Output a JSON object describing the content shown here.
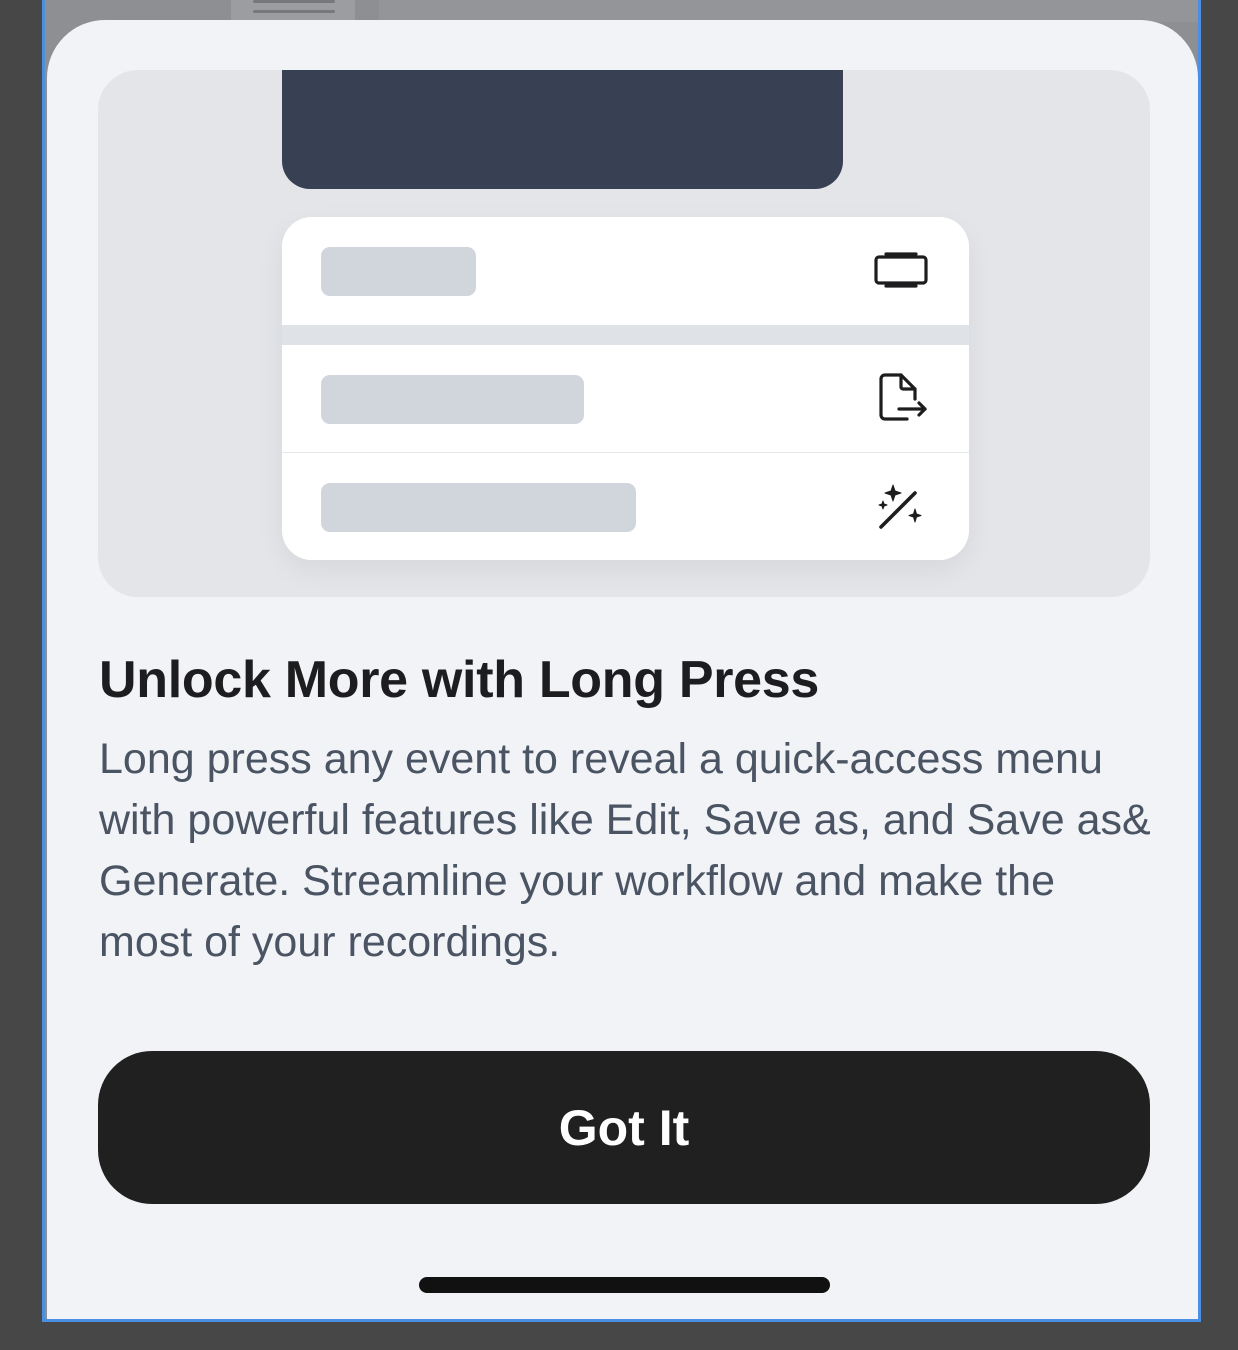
{
  "sheet": {
    "title": "Unlock More with Long Press",
    "description": "Long press any event to reveal a quick-access menu with powerful features like Edit, Save as, and Save as& Generate. Streamline your workflow and make the most of your recordings.",
    "button_label": "Got It"
  },
  "illustration": {
    "menu_icons": [
      "edit-frame-icon",
      "file-export-icon",
      "magic-wand-icon"
    ]
  },
  "colors": {
    "sheet_background": "#f1f3f7",
    "illustration_background": "#e3e5e9",
    "dark_card": "#374153",
    "button_background": "#202020",
    "button_text": "#ffffff",
    "title_text": "#1d1d1f",
    "body_text": "#4b5463"
  }
}
